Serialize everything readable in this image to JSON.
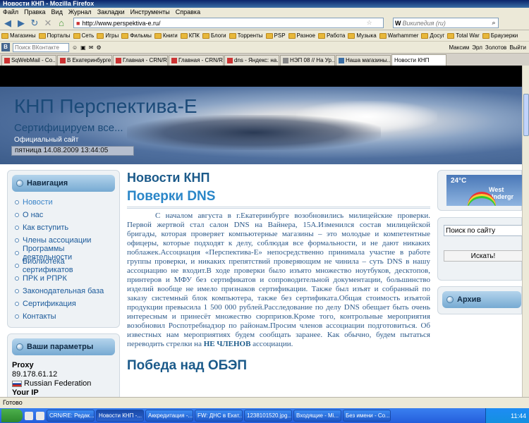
{
  "window": {
    "title": "Новости КНП - Mozilla Firefox"
  },
  "menu": [
    "Файл",
    "Правка",
    "Вид",
    "Журнал",
    "Закладки",
    "Инструменты",
    "Справка"
  ],
  "nav": {
    "url": "http://www.perspektiva-e.ru/",
    "search_placeholder": "Википедия (ru)"
  },
  "bookmarks": [
    "Магазины",
    "Порталы",
    "Сеть",
    "Игры",
    "Фильмы",
    "Книги",
    "КПК",
    "Блоги",
    "Торренты",
    "PSP",
    "Разное",
    "Работа",
    "Музыка",
    "Warhammer",
    "Досуг",
    "Total War",
    "Браузерки"
  ],
  "toolbar2": {
    "search_placeholder": "Поиск ВКонтакте",
    "right_items": [
      "Максим",
      "Эрл",
      "Золотов",
      "Выйти"
    ]
  },
  "tabs": [
    {
      "label": "SqWebMail - Co..."
    },
    {
      "label": "В Екатеринбурге..."
    },
    {
      "label": "Главная - CRN/RE"
    },
    {
      "label": "Главная - CRN/RE"
    },
    {
      "label": "dns - Яндекс: на..."
    },
    {
      "label": "НЭП 08 // На Ур..."
    },
    {
      "label": "Наша магазины..."
    },
    {
      "label": "Новости КНП"
    }
  ],
  "site": {
    "title": "КНП Перспектива-Е",
    "slogan": "Сертифицируем все...",
    "official": "Официальный сайт",
    "date": "пятница 14.08.2009 13:44:05"
  },
  "nav_panel": {
    "header": "Навигация",
    "items": [
      "Новости",
      "О нас",
      "Как вступить",
      "Члены ассоциации",
      "Программы деятельности",
      "Библиотека сертификатов",
      "ПРК и РПРК",
      "Законодательная база",
      "Сертификация",
      "Контакты"
    ]
  },
  "params_panel": {
    "header": "Ваши параметры",
    "proxy_label": "Proxy",
    "ip": "89.178.61.12",
    "country": "Russian Federation",
    "your_ip_label": "Your IP"
  },
  "main": {
    "heading": "Новости КНП",
    "article_title": "Поверки DNS",
    "article_body": "С началом августа в г.Екатеринбурге возобновились милицейские проверки. Первой жертвой стал салон DNS на Вайнера, 15А.Изменился состав милицейской бригады, которая проверяет компьютерные магазины – это молодые и компетентные офицеры, которые подходят к делу, соблюдая все формальности, и не дают никаких поблажек.Ассоциация «Перспектива-Е» непосредственно принимала участие в работе группы проверки, и никаких препятствий проверяющим не чинила – суть DNS в нашу ассоциацию не входит.В ходе проверки было изъято множество ноутбуков, десктопов, принтеров и МФУ без сертификатов и сопроводительной документации, большинство изделий вообще не имело признаков сертификации. Также был изъят и собранный по заказу системный блок компьютера, также без сертификата.Общая стоимость изъятой продукции превысила 1 500 000 рублей.Расследование по делу DNS обещает быть очень интересным и принесёт множество сюрпризов.Кроме того, контрольные мероприятия возобновил Роспотребнадзор по районам.Просим членов ассоциации подготовиться. Об известных нам мероприятиях будем сообщать заранее. Как обычно, будем пытаться переводить стрелки на ",
    "article_bold": "НЕ ЧЛЕНОВ",
    "article_tail": " ассоциации.",
    "article2_title": "Победа над ОБЭП"
  },
  "weather": {
    "temp": "24°C",
    "location": "West Undergr"
  },
  "search_panel": {
    "placeholder": "Поиск по сайту",
    "button": "Искать!"
  },
  "archive": {
    "header": "Архив"
  },
  "status": {
    "text": "Готово"
  },
  "taskbar": {
    "tasks": [
      "CRN/RE: Редак...",
      "Новости КНП -...",
      "Аккредитация -...",
      "FW: ДНС в Екат...",
      "1238101520.jpg...",
      "Входящие - Mi...",
      "Без имени - Со..."
    ],
    "clock": "11:44"
  }
}
